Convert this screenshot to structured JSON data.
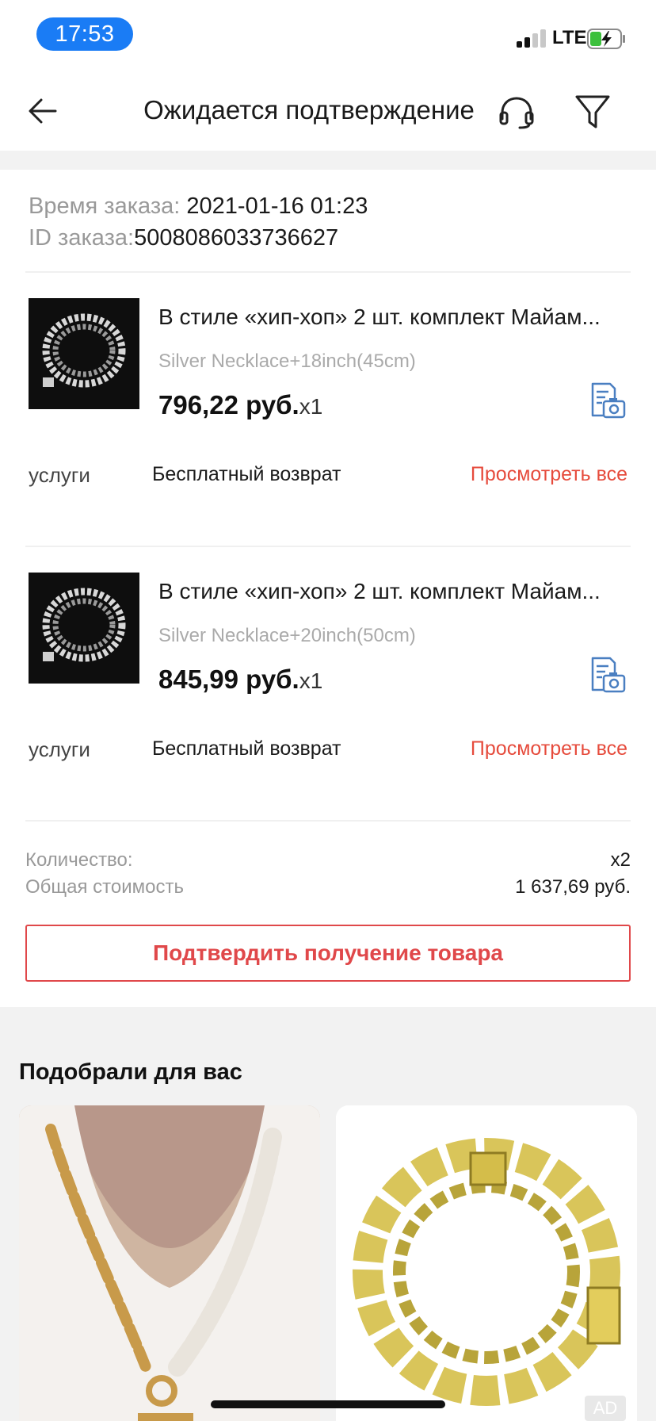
{
  "status_bar": {
    "time": "17:53",
    "network": "LTE",
    "signal_bars": 2,
    "battery_charging": true
  },
  "header": {
    "title": "Ожидается подтверждение",
    "back_icon": "arrow-left-icon",
    "support_icon": "headset-icon",
    "filter_icon": "filter-icon"
  },
  "order": {
    "time_label": "Время заказа:",
    "time_value": "2021-01-16 01:23",
    "id_label": "ID заказа:",
    "id_value": "5008086033736627"
  },
  "products": [
    {
      "title": "В стиле «хип-хоп» 2 шт. комплект Майам...",
      "variant": "Silver Necklace+18inch(45cm)",
      "price": "796,22 руб.",
      "quantity": "x1",
      "services_label": "услуги",
      "services_value": "Бесплатный возврат",
      "view_all": "Просмотреть все"
    },
    {
      "title": "В стиле «хип-хоп» 2 шт. комплект Майам...",
      "variant": "Silver Necklace+20inch(50cm)",
      "price": "845,99 руб.",
      "quantity": "x1",
      "services_label": "услуги",
      "services_value": "Бесплатный возврат",
      "view_all": "Просмотреть все"
    }
  ],
  "totals": {
    "quantity_label": "Количество:",
    "quantity_value": "x2",
    "total_label": "Общая стоимость",
    "total_value": "1 637,69 руб."
  },
  "confirm_button": "Подтвердить получение товара",
  "recommendations": {
    "title": "Подобрали для вас",
    "ad_badge": "AD"
  },
  "colors": {
    "accent_red": "#e0484a",
    "link_red": "#e64b3c",
    "time_pill": "#1a7cf5",
    "icon_blue": "#4a7fc1",
    "battery_green": "#3cc03c"
  }
}
